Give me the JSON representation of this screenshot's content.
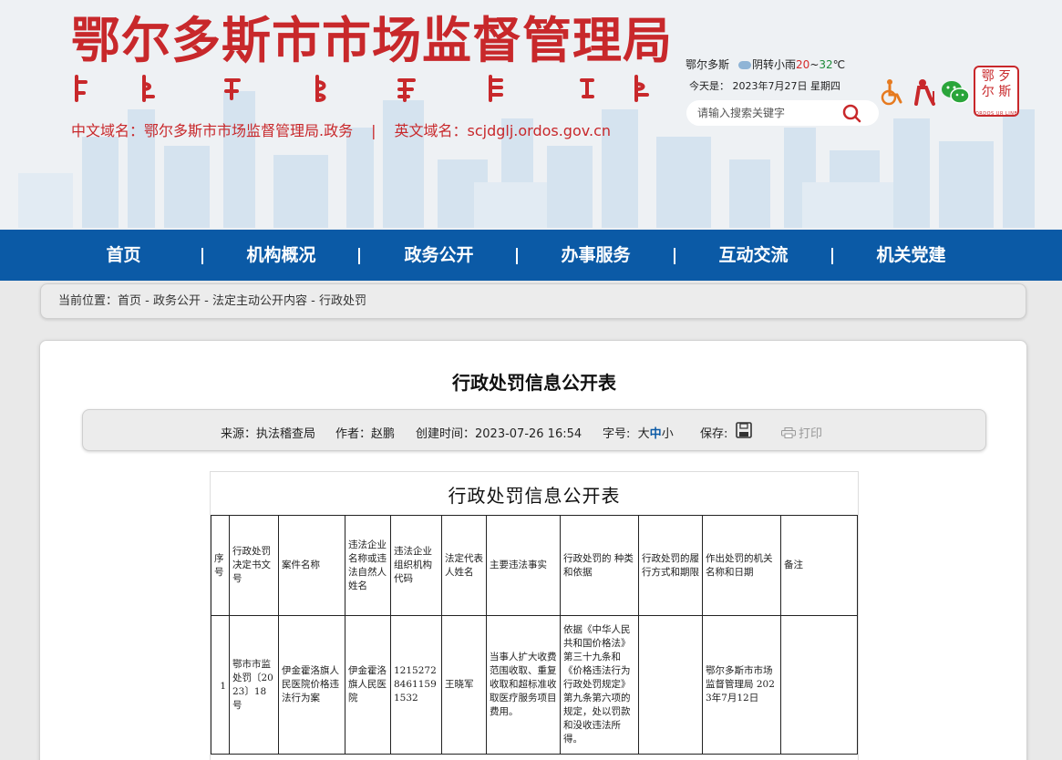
{
  "header": {
    "site_title": "鄂尔多斯市市场监督管理局",
    "domain_cn_label": "中文域名：鄂尔多斯市市场监督管理局.政务",
    "separator": "|",
    "domain_en_label": "英文域名：scjdglj.ordos.gov.cn",
    "weather": {
      "city": "鄂尔多斯",
      "condition": "阴转小雨",
      "low": "20",
      "tilde": "~",
      "high": "32",
      "tail": "℃"
    },
    "date_text": "今天是： 2023年7月27日 星期四",
    "search": {
      "placeholder": "请输入搜索关键字"
    },
    "logo": {
      "line1": "鄂 歹",
      "line2": "尔 斯",
      "caption": "ORDOS UR LINE"
    }
  },
  "nav": {
    "items": [
      "首页",
      "机构概况",
      "政务公开",
      "办事服务",
      "互动交流",
      "机关党建"
    ]
  },
  "breadcrumb": {
    "prefix": "当前位置：",
    "items": [
      "首页",
      "政务公开",
      "法定主动公开内容",
      "行政处罚"
    ],
    "sep": " - "
  },
  "article": {
    "title": "行政处罚信息公开表",
    "source": "来源：执法稽查局",
    "author": "作者：赵鹏",
    "created": "创建时间：2023-07-26 16:54",
    "font_size_label": "字号:",
    "font_sizes": [
      "大",
      "中",
      "小"
    ],
    "save_label": "保存:",
    "print_label": "打印"
  },
  "document": {
    "title": "行政处罚信息公开表",
    "headers": [
      "序号",
      "行政处罚决定书文号",
      "案件名称",
      "违法企业名称或违法自然人姓名",
      "违法企业组织机构代码",
      "法定代表人姓名",
      "主要违法事实",
      "行政处罚的  种类和依据",
      "行政处罚的履行方式和期限",
      "作出处罚的机关名称和日期",
      "备注"
    ],
    "rows": [
      [
        "1",
        "鄂市市监处罚〔2023〕18号",
        "伊金霍洛旗人民医院价格违法行为案",
        "伊金霍洛旗人民医院",
        "121527284611591532",
        "王晓军",
        "当事人扩大收费范围收取、重复收取和超标准收取医疗服务项目费用。",
        "依据《中华人民共和国价格法》第三十九条和《价格违法行为行政处罚规定》第九条第六项的规定，处以罚款和没收违法所得。",
        "",
        "鄂尔多斯市市场监督管理局 2023年7月12日",
        ""
      ]
    ]
  }
}
